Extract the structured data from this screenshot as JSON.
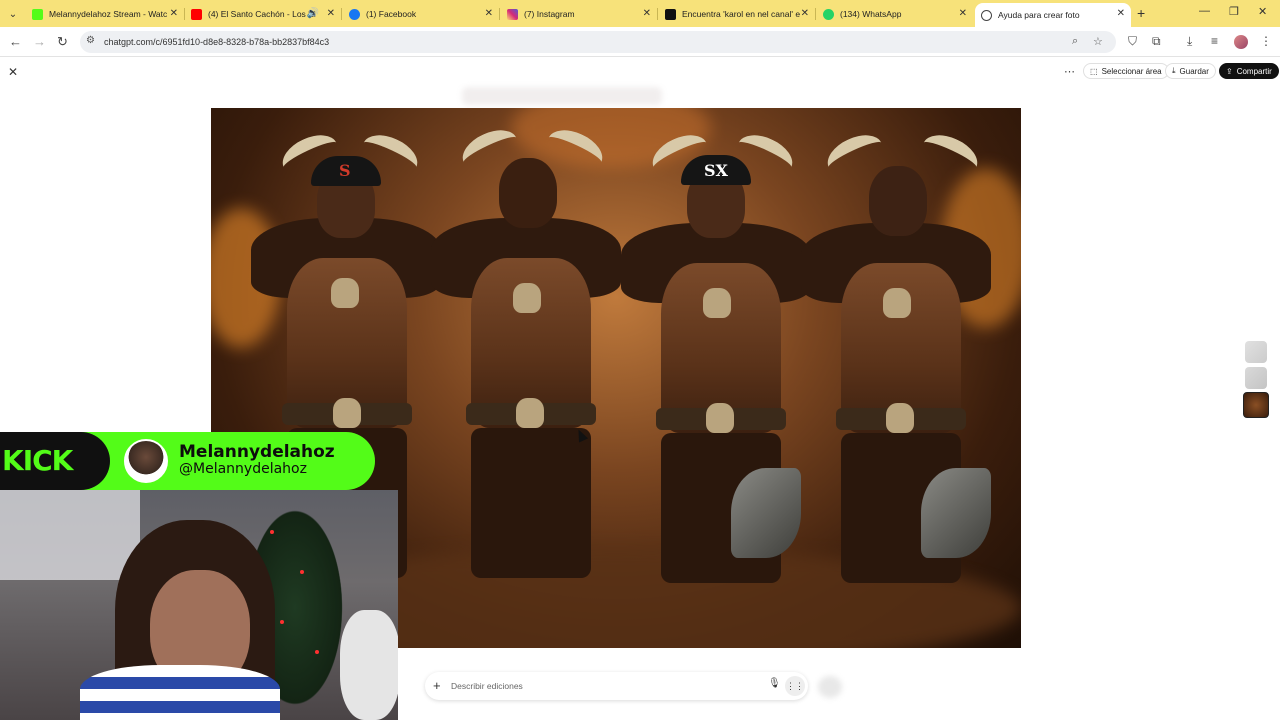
{
  "browser": {
    "tabs": [
      {
        "title": "Melannydelahoz Stream - Watc",
        "favicon_color": "#53fc18",
        "active": false
      },
      {
        "title": "(4) El Santo Cachón - Los Ei",
        "favicon_color": "#ff0000",
        "active": false
      },
      {
        "title": "(1) Facebook",
        "favicon_color": "#1877f2",
        "active": false
      },
      {
        "title": "(7) Instagram",
        "favicon_color": "#d62976",
        "active": false
      },
      {
        "title": "Encuentra 'karol en nel canal' e",
        "favicon_color": "#111111",
        "active": false
      },
      {
        "title": "(134) WhatsApp",
        "favicon_color": "#25d366",
        "active": false
      },
      {
        "title": "Ayuda para crear foto",
        "favicon_color": "#444444",
        "active": true
      }
    ],
    "url": "chatgpt.com/c/6951fd10-d8e8-8328-b78a-bb2837bf84c3"
  },
  "header": {
    "select_area_label": "Seleccionar área",
    "save_label": "Guardar",
    "share_label": "Compartir"
  },
  "image": {
    "figures": [
      {
        "cap_logo": "S",
        "cap_color": "#151515",
        "logo_color": "#d23a2a"
      },
      {
        "cap_logo": "",
        "cap_color": "",
        "logo_color": ""
      },
      {
        "cap_logo": "SX",
        "cap_color": "#151515",
        "logo_color": "#ffffff"
      },
      {
        "cap_logo": "",
        "cap_color": "",
        "logo_color": ""
      }
    ]
  },
  "prompt": {
    "placeholder": "Describir ediciones"
  },
  "overlay": {
    "brand": "KICK",
    "brand_color": "#53fc18",
    "streamer_name": "Melannydelahoz",
    "streamer_handle": "@Melannydelahoz"
  }
}
